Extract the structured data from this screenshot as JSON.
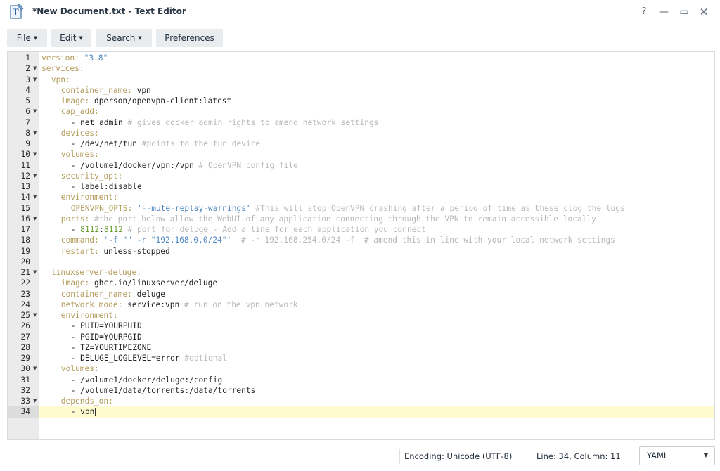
{
  "window": {
    "title": "*New Document.txt - Text Editor",
    "controls": {
      "help": "?",
      "minimize": "—",
      "maximize": "▭",
      "close": "✕"
    }
  },
  "menu": [
    {
      "label": "File",
      "has_dropdown": true
    },
    {
      "label": "Edit",
      "has_dropdown": true
    },
    {
      "label": "Search",
      "has_dropdown": true
    },
    {
      "label": "Preferences",
      "has_dropdown": false
    }
  ],
  "editor": {
    "active_line": 34,
    "lines": [
      {
        "n": "1",
        "fold": false,
        "indent": 0,
        "tokens": [
          [
            "k",
            "version: "
          ],
          [
            "s",
            "\"3.8\""
          ]
        ]
      },
      {
        "n": "2",
        "fold": true,
        "indent": 0,
        "tokens": [
          [
            "k",
            "services:"
          ]
        ]
      },
      {
        "n": "3",
        "fold": true,
        "indent": 2,
        "tokens": [
          [
            "k",
            "vpn:"
          ]
        ]
      },
      {
        "n": "4",
        "fold": false,
        "indent": 4,
        "tokens": [
          [
            "k",
            "container_name: "
          ],
          [
            "t",
            "vpn"
          ]
        ]
      },
      {
        "n": "5",
        "fold": false,
        "indent": 4,
        "tokens": [
          [
            "k",
            "image: "
          ],
          [
            "t",
            "dperson/openvpn-client:latest"
          ]
        ]
      },
      {
        "n": "6",
        "fold": true,
        "indent": 4,
        "tokens": [
          [
            "k",
            "cap_add:"
          ]
        ]
      },
      {
        "n": "7",
        "fold": false,
        "indent": 6,
        "tokens": [
          [
            "t",
            "- net_admin "
          ],
          [
            "c",
            "# gives docker admin rights to amend network settings"
          ]
        ]
      },
      {
        "n": "8",
        "fold": true,
        "indent": 4,
        "tokens": [
          [
            "k",
            "devices:"
          ]
        ]
      },
      {
        "n": "9",
        "fold": false,
        "indent": 6,
        "tokens": [
          [
            "t",
            "- /dev/net/tun "
          ],
          [
            "c",
            "#points to the tun device"
          ]
        ]
      },
      {
        "n": "10",
        "fold": true,
        "indent": 4,
        "tokens": [
          [
            "k",
            "volumes:"
          ]
        ]
      },
      {
        "n": "11",
        "fold": false,
        "indent": 6,
        "tokens": [
          [
            "t",
            "- /volume1/docker/vpn:/vpn "
          ],
          [
            "c",
            "# OpenVPN config file"
          ]
        ]
      },
      {
        "n": "12",
        "fold": true,
        "indent": 4,
        "tokens": [
          [
            "k",
            "security_opt:"
          ]
        ]
      },
      {
        "n": "13",
        "fold": false,
        "indent": 6,
        "tokens": [
          [
            "t",
            "- label:disable"
          ]
        ]
      },
      {
        "n": "14",
        "fold": true,
        "indent": 4,
        "tokens": [
          [
            "k",
            "environment:"
          ]
        ]
      },
      {
        "n": "15",
        "fold": false,
        "indent": 6,
        "tokens": [
          [
            "k",
            "OPENVPN_OPTS: "
          ],
          [
            "s",
            "'--mute-replay-warnings'"
          ],
          [
            "c",
            " #This will stop OpenVPN crashing after a period of time as these clog the logs"
          ]
        ]
      },
      {
        "n": "16",
        "fold": true,
        "indent": 4,
        "tokens": [
          [
            "k",
            "ports: "
          ],
          [
            "c",
            "#the port below allow the WebUI of any application connecting through the VPN to remain accessible locally"
          ]
        ]
      },
      {
        "n": "17",
        "fold": false,
        "indent": 6,
        "tokens": [
          [
            "t",
            "- "
          ],
          [
            "n",
            "8112"
          ],
          [
            "t",
            ":"
          ],
          [
            "n",
            "8112"
          ],
          [
            "c",
            " # port for deluge - Add a line for each application you connect"
          ]
        ]
      },
      {
        "n": "18",
        "fold": false,
        "indent": 4,
        "tokens": [
          [
            "k",
            "command: "
          ],
          [
            "s",
            "'-f \"\" -r \"192.168.0.0/24\"'"
          ],
          [
            "c",
            "  # -r 192.168.254.0/24 -f  # amend this in line with your local network settings"
          ]
        ]
      },
      {
        "n": "19",
        "fold": false,
        "indent": 4,
        "tokens": [
          [
            "k",
            "restart: "
          ],
          [
            "t",
            "unless-stopped"
          ]
        ]
      },
      {
        "n": "20",
        "fold": false,
        "indent": 0,
        "tokens": []
      },
      {
        "n": "21",
        "fold": true,
        "indent": 2,
        "tokens": [
          [
            "k",
            "linuxserver-deluge:"
          ]
        ]
      },
      {
        "n": "22",
        "fold": false,
        "indent": 4,
        "tokens": [
          [
            "k",
            "image: "
          ],
          [
            "t",
            "ghcr.io/linuxserver/deluge"
          ]
        ]
      },
      {
        "n": "23",
        "fold": false,
        "indent": 4,
        "tokens": [
          [
            "k",
            "container_name: "
          ],
          [
            "t",
            "deluge"
          ]
        ]
      },
      {
        "n": "24",
        "fold": false,
        "indent": 4,
        "tokens": [
          [
            "k",
            "network_mode: "
          ],
          [
            "t",
            "service:vpn "
          ],
          [
            "c",
            "# run on the vpn network"
          ]
        ]
      },
      {
        "n": "25",
        "fold": true,
        "indent": 4,
        "tokens": [
          [
            "k",
            "environment:"
          ]
        ]
      },
      {
        "n": "26",
        "fold": false,
        "indent": 6,
        "tokens": [
          [
            "t",
            "- PUID=YOURPUID"
          ]
        ]
      },
      {
        "n": "27",
        "fold": false,
        "indent": 6,
        "tokens": [
          [
            "t",
            "- PGID=YOURPGID"
          ]
        ]
      },
      {
        "n": "28",
        "fold": false,
        "indent": 6,
        "tokens": [
          [
            "t",
            "- TZ=YOURTIMEZONE"
          ]
        ]
      },
      {
        "n": "29",
        "fold": false,
        "indent": 6,
        "tokens": [
          [
            "t",
            "- DELUGE_LOGLEVEL=error "
          ],
          [
            "c",
            "#optional"
          ]
        ]
      },
      {
        "n": "30",
        "fold": true,
        "indent": 4,
        "tokens": [
          [
            "k",
            "volumes:"
          ]
        ]
      },
      {
        "n": "31",
        "fold": false,
        "indent": 6,
        "tokens": [
          [
            "t",
            "- /volume1/docker/deluge:/config"
          ]
        ]
      },
      {
        "n": "32",
        "fold": false,
        "indent": 6,
        "tokens": [
          [
            "t",
            "- /volume1/data/torrents:/data/torrents"
          ]
        ]
      },
      {
        "n": "33",
        "fold": true,
        "indent": 4,
        "tokens": [
          [
            "k",
            "depends_on:"
          ]
        ]
      },
      {
        "n": "34",
        "fold": false,
        "indent": 6,
        "tokens": [
          [
            "t",
            "- vpn"
          ]
        ]
      }
    ]
  },
  "status": {
    "encoding": "Encoding: Unicode (UTF-8)",
    "position": "Line: 34, Column: 11",
    "mode": "YAML"
  },
  "colors": {
    "key": "#b39b5a",
    "string": "#4c86bf",
    "comment": "#b7b7b7",
    "number": "#6b9c30",
    "active_line": "#fffbd1",
    "gutter": "#ebebeb"
  }
}
